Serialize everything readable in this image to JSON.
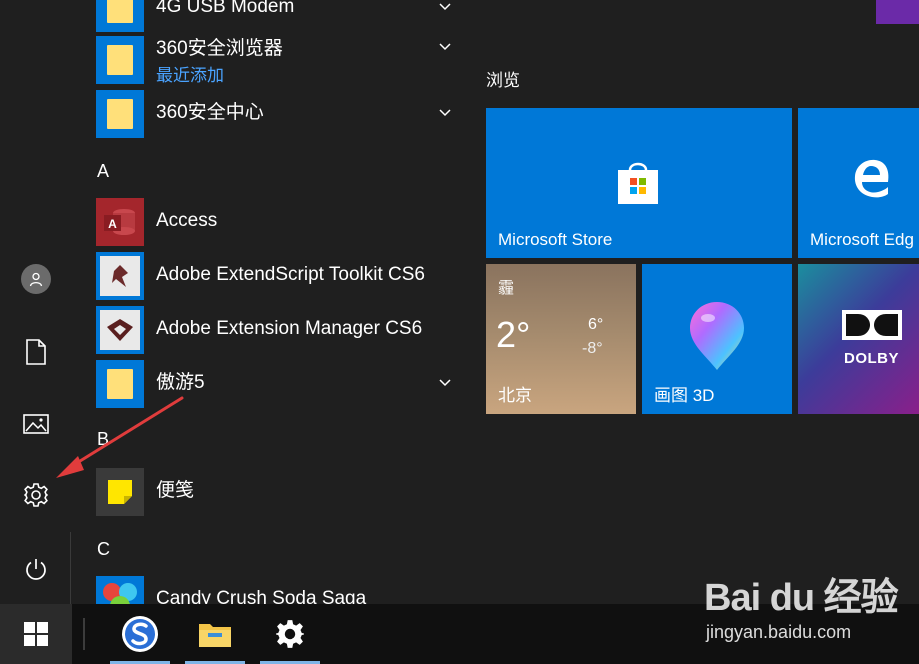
{
  "rail": {
    "items": [
      {
        "name": "account",
        "icon": "user-avatar-icon"
      },
      {
        "name": "documents",
        "icon": "document-icon"
      },
      {
        "name": "pictures",
        "icon": "picture-icon"
      },
      {
        "name": "settings",
        "icon": "gear-icon"
      },
      {
        "name": "power",
        "icon": "power-icon"
      }
    ]
  },
  "app_list": {
    "items": [
      {
        "label": "4G USB Modem",
        "icon": "folder-icon",
        "expandable": true
      },
      {
        "label": "360安全浏览器",
        "sublabel": "最近添加",
        "icon": "folder-icon",
        "expandable": true
      },
      {
        "label": "360安全中心",
        "icon": "folder-icon",
        "expandable": true
      },
      {
        "letter": "A"
      },
      {
        "label": "Access",
        "icon": "access-icon"
      },
      {
        "label": "Adobe ExtendScript Toolkit CS6",
        "icon": "extendscript-icon"
      },
      {
        "label": "Adobe Extension Manager CS6",
        "icon": "extension-manager-icon"
      },
      {
        "label": "傲游5",
        "icon": "folder-icon",
        "expandable": true
      },
      {
        "letter": "B"
      },
      {
        "label": "便笺",
        "icon": "sticky-notes-icon"
      },
      {
        "letter": "C"
      },
      {
        "label": "Candy Crush Soda Saga",
        "icon": "candy-crush-icon"
      }
    ]
  },
  "tiles": {
    "group_label": "浏览",
    "store": {
      "label": "Microsoft Store",
      "color": "#0078d7"
    },
    "edge": {
      "label": "Microsoft Edg",
      "color": "#0078d7"
    },
    "weather": {
      "condition": "霾",
      "temp": "2°",
      "high": "6°",
      "low": "-8°",
      "city": "北京"
    },
    "paint3d": {
      "label": "画图 3D",
      "color": "#0078d7"
    },
    "dolby": {
      "label": "DOLBY"
    }
  },
  "taskbar": {
    "items": [
      "sogou-browser-icon",
      "file-explorer-icon",
      "settings-gear-icon"
    ]
  },
  "watermark": {
    "logo": "Bai du 经验",
    "url": "jingyan.baidu.com"
  },
  "colors": {
    "accent": "#0078d7",
    "background": "#1f1f1f",
    "taskbar": "#101010",
    "annotation_arrow": "#e03c3c"
  }
}
